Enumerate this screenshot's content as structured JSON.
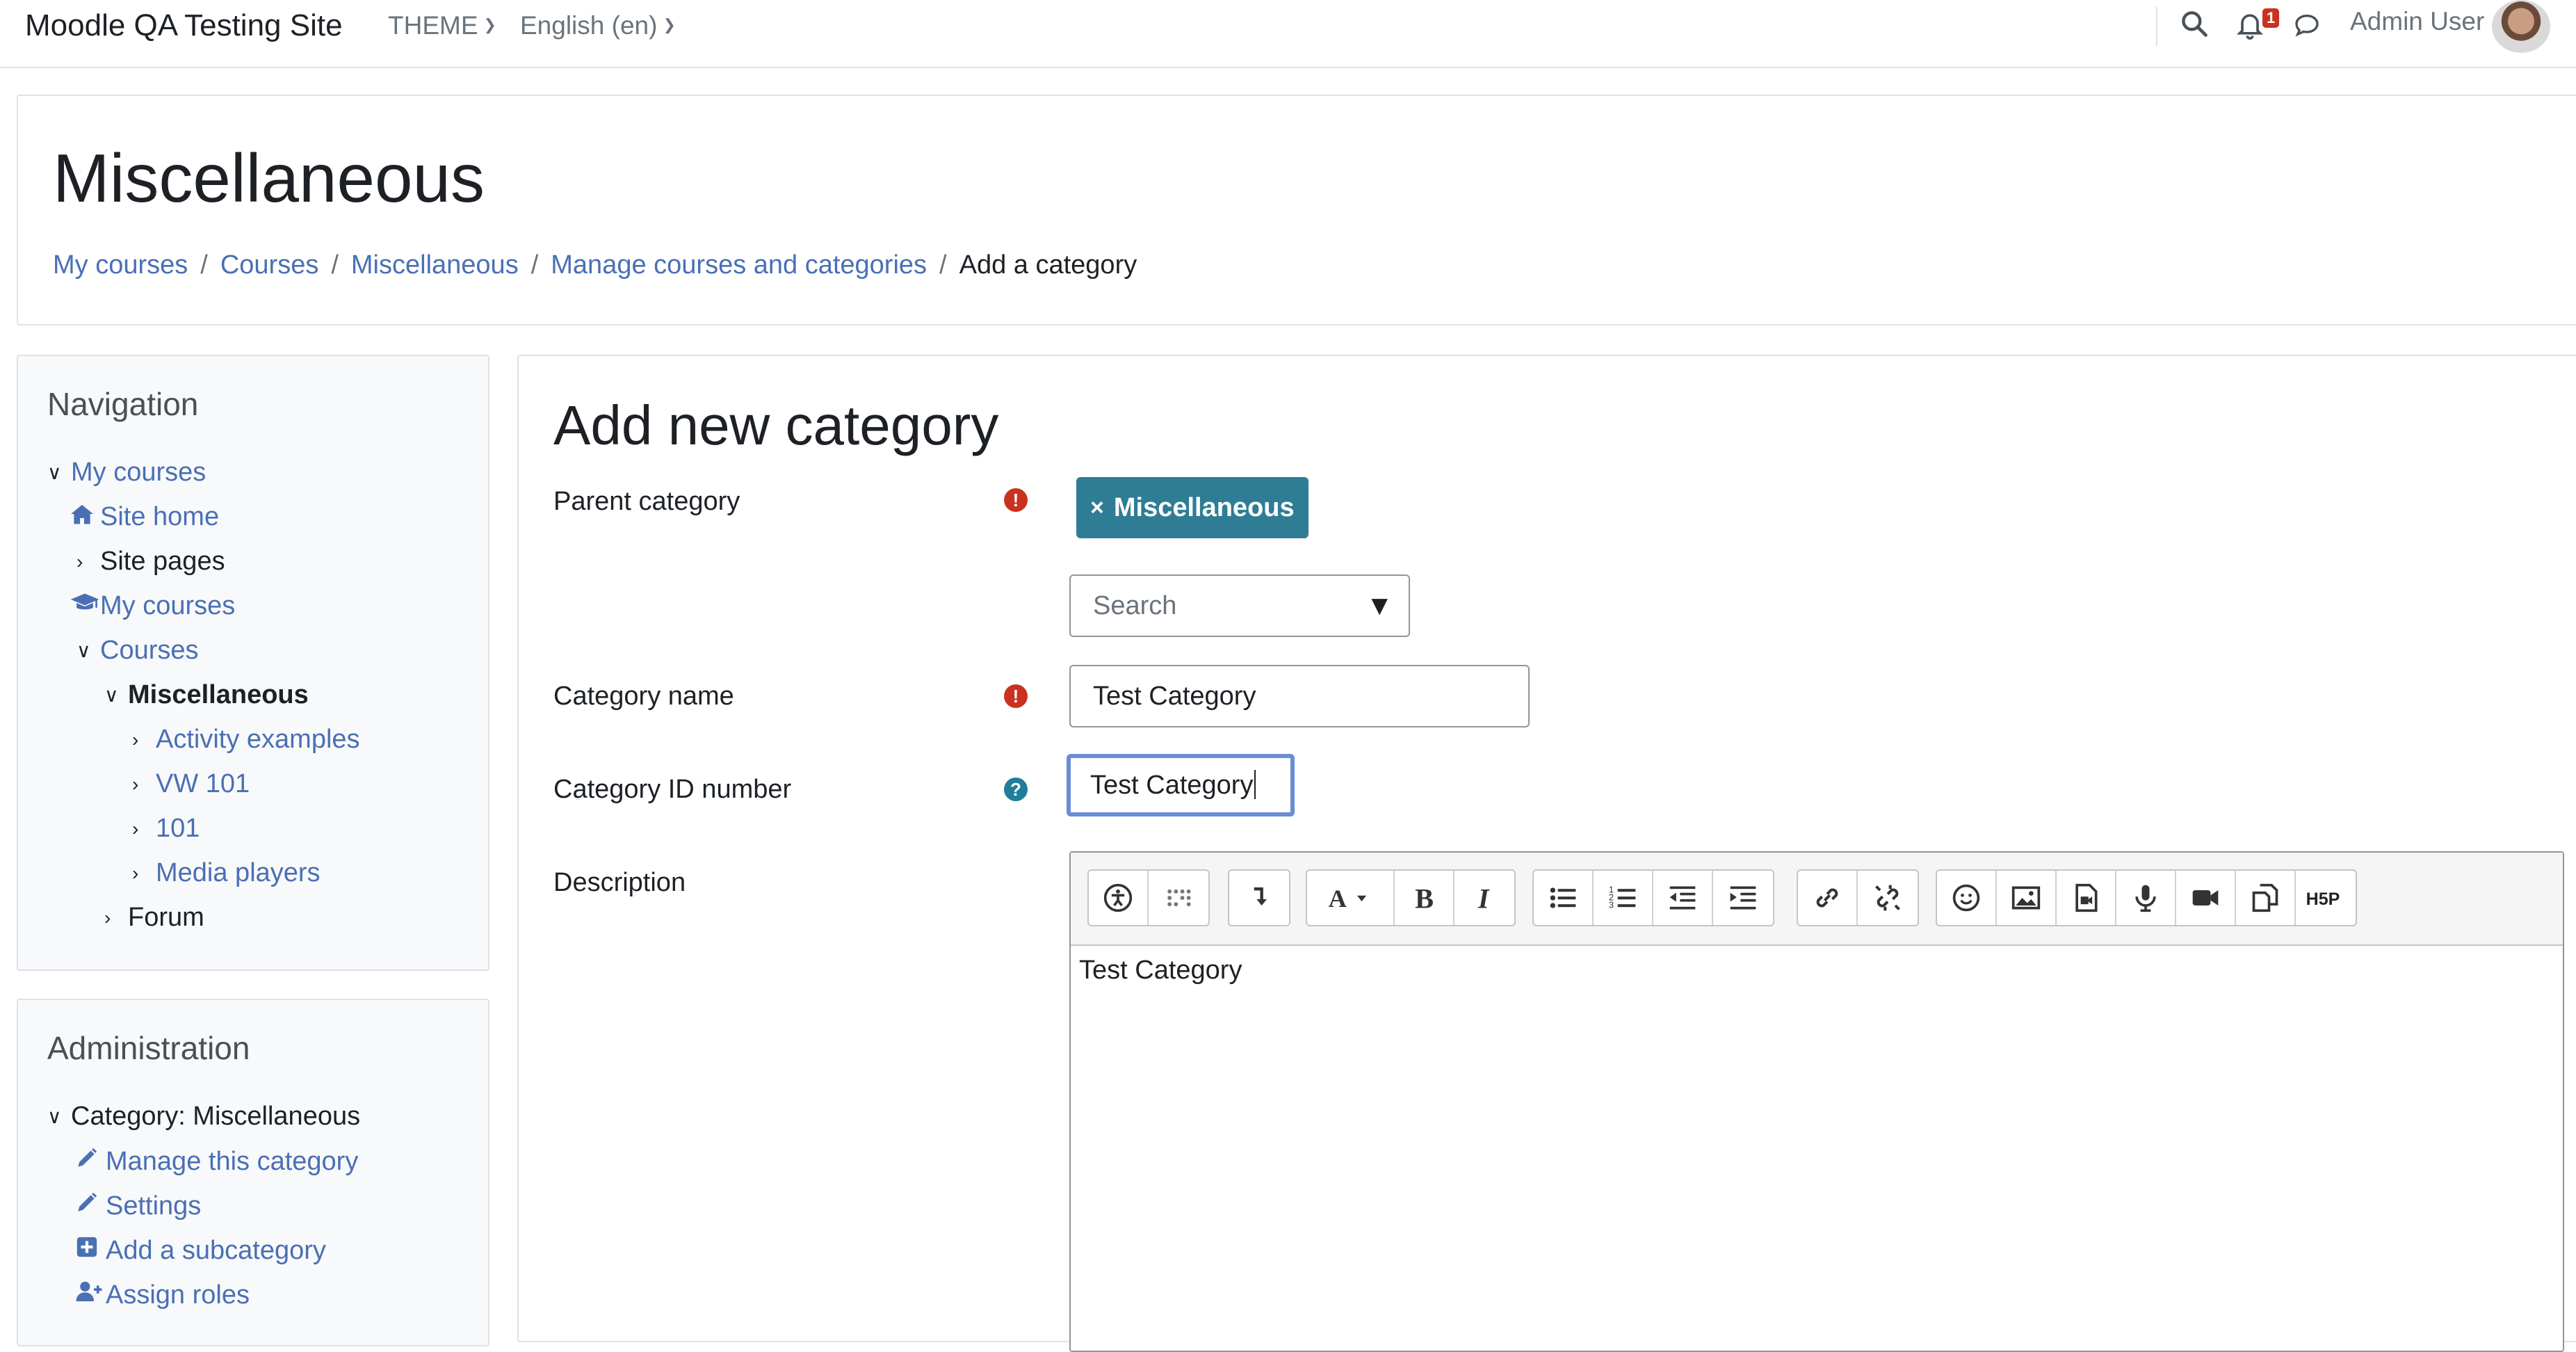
{
  "navbar": {
    "site_name": "Moodle QA Testing Site",
    "theme_menu": "THEME",
    "language_menu": "English (en)",
    "notification_count": "1",
    "user_name": "Admin User"
  },
  "header": {
    "page_title": "Miscellaneous",
    "breadcrumb": [
      {
        "label": "My courses"
      },
      {
        "label": "Courses"
      },
      {
        "label": "Miscellaneous"
      },
      {
        "label": "Manage courses and categories"
      },
      {
        "label": "Add a category"
      }
    ],
    "breadcrumb_separator": "/"
  },
  "navigation": {
    "title": "Navigation",
    "items": [
      {
        "label": "My courses"
      },
      {
        "label": "Site home"
      },
      {
        "label": "Site pages"
      },
      {
        "label": "My courses"
      },
      {
        "label": "Courses"
      },
      {
        "label": "Miscellaneous"
      },
      {
        "label": "Activity examples"
      },
      {
        "label": "VW 101"
      },
      {
        "label": "101"
      },
      {
        "label": "Media players"
      },
      {
        "label": "Forum"
      }
    ]
  },
  "administration": {
    "title": "Administration",
    "items": [
      {
        "label": "Category: Miscellaneous"
      },
      {
        "label": "Manage this category"
      },
      {
        "label": "Settings"
      },
      {
        "label": "Add a subcategory"
      },
      {
        "label": "Assign roles"
      }
    ]
  },
  "form": {
    "heading": "Add new category",
    "parent_category_label": "Parent category",
    "parent_category_tag": "Miscellaneous",
    "tag_remove_symbol": "×",
    "search_placeholder": "Search",
    "category_name_label": "Category name",
    "category_name_value": "Test Category",
    "category_id_label": "Category ID number",
    "category_id_value": "Test Category",
    "description_label": "Description",
    "description_value": "Test Category"
  },
  "editor_toolbar": [
    [
      "accessibility-checker-icon",
      "screenreader-helper-icon"
    ],
    [
      "collapse-toolbar-icon"
    ],
    [
      "font-style-icon",
      "bold-icon",
      "italic-icon"
    ],
    [
      "unordered-list-icon",
      "ordered-list-icon",
      "outdent-icon",
      "indent-icon"
    ],
    [
      "link-icon",
      "unlink-icon"
    ],
    [
      "emoji-icon",
      "image-icon",
      "media-icon",
      "record-audio-icon",
      "record-video-icon",
      "manage-files-icon",
      "h5p-icon"
    ]
  ],
  "colors": {
    "link": "#4a6fb5",
    "tag_bg": "#2f7d95",
    "required_icon": "#ca3120",
    "help_icon": "#1f7e9a",
    "focus_border": "#6b8dd6"
  }
}
